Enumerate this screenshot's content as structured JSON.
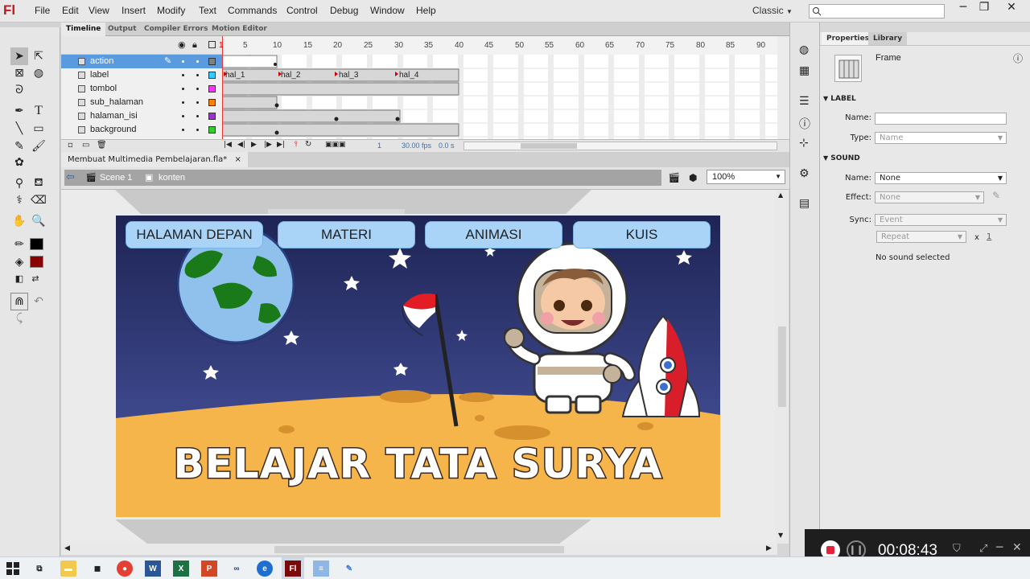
{
  "app": {
    "logo": "Fl",
    "workspace": "Classic"
  },
  "menu": [
    "File",
    "Edit",
    "View",
    "Insert",
    "Modify",
    "Text",
    "Commands",
    "Control",
    "Debug",
    "Window",
    "Help"
  ],
  "timeline": {
    "tabs": [
      "Timeline",
      "Output",
      "Compiler Errors",
      "Motion Editor"
    ],
    "ruler": [
      "1",
      "5",
      "10",
      "15",
      "20",
      "25",
      "30",
      "35",
      "40",
      "45",
      "50",
      "55",
      "60",
      "65",
      "70",
      "75",
      "80",
      "85",
      "90"
    ],
    "layers": [
      {
        "name": "action",
        "color": "#7f7f7f",
        "selected": true
      },
      {
        "name": "label",
        "color": "#33ccff"
      },
      {
        "name": "tombol",
        "color": "#ff33ff"
      },
      {
        "name": "sub_halaman",
        "color": "#ff8000"
      },
      {
        "name": "halaman_isi",
        "color": "#9933cc"
      },
      {
        "name": "background",
        "color": "#33cc33"
      }
    ],
    "frame_labels": [
      "hal_1",
      "hal_2",
      "hal_3",
      "hal_4"
    ],
    "current_frame": "1",
    "fps": "30.00 fps",
    "time": "0.0 s"
  },
  "document": {
    "tab_name": "Membuat Multimedia Pembelajaran.fla*",
    "scene": "Scene 1",
    "symbol": "konten",
    "zoom": "100%"
  },
  "stage": {
    "nav": [
      "HALAMAN DEPAN",
      "MATERI",
      "ANIMASI",
      "KUIS"
    ],
    "title": "BELAJAR TATA SURYA",
    "colors": {
      "sky_top": "#1e2454",
      "sky_bottom": "#4d5aa8",
      "ground": "#f5b54a",
      "button": "#a9d3f7"
    }
  },
  "properties": {
    "tabs": [
      "Properties",
      "Library"
    ],
    "kind": "Frame",
    "label_section": "LABEL",
    "name_label": "Name:",
    "name_value": "",
    "type_label": "Type:",
    "type_value": "Name",
    "sound_section": "SOUND",
    "sound_name_label": "Name:",
    "sound_name_value": "None",
    "effect_label": "Effect:",
    "effect_value": "None",
    "sync_label": "Sync:",
    "sync_value": "Event",
    "repeat_value": "Repeat",
    "repeat_x": "x",
    "repeat_count": "1",
    "no_sound": "No sound selected"
  },
  "recorder": {
    "timer": "00:08:43"
  }
}
